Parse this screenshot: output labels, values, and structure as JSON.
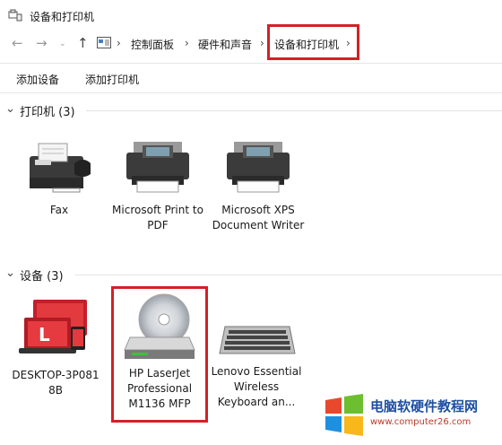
{
  "window": {
    "title": "设备和打印机"
  },
  "nav": {
    "back_glyph": "←",
    "forward_glyph": "→",
    "dropdown_glyph": "⌄",
    "up_glyph": "↑",
    "breadcrumb_sep": "›",
    "breadcrumbs": [
      "控制面板",
      "硬件和声音",
      "设备和打印机"
    ]
  },
  "toolbar": {
    "add_device": "添加设备",
    "add_printer": "添加打印机"
  },
  "printers_section": {
    "title": "打印机 (3)",
    "items": [
      {
        "label": "Fax",
        "icon": "fax-icon"
      },
      {
        "label": "Microsoft Print to PDF",
        "icon": "printer-icon"
      },
      {
        "label": "Microsoft XPS Document Writer",
        "icon": "printer-icon"
      }
    ]
  },
  "devices_section": {
    "title": "设备 (3)",
    "items": [
      {
        "label": "DESKTOP-3P0818B",
        "icon": "computer-icon"
      },
      {
        "label": "HP LaserJet Professional M1136 MFP",
        "icon": "disc-drive-icon"
      },
      {
        "label": "Lenovo Essential Wireless Keyboard an...",
        "icon": "keyboard-icon"
      }
    ]
  },
  "watermark": {
    "text": "电脑软硬件教程网",
    "url": "www.computer26.com"
  },
  "colors": {
    "highlight": "#d42027",
    "link_blue": "#1d4fa3",
    "icon_dark": "#333333"
  }
}
